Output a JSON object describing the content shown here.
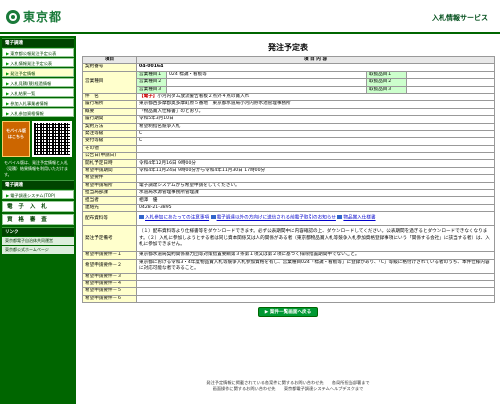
{
  "header": {
    "logo_text": "東京都",
    "service_title": "入札情報サービス"
  },
  "sidebar": {
    "section1": "電子調達",
    "items1": [
      "東京都公報発注予定公表",
      "入札情報発注予定公表",
      "発注予定情報",
      "入札見積(競)経過情報",
      "入札結果一覧",
      "参加入札事業者情報",
      "入札参加資格情報"
    ],
    "mobile_label": "モバイル版",
    "mobile_sub": "はこちら",
    "note": "モバイル版は、発注予定情報と入札（見積）結果情報を利用いただけます。",
    "section2": "電子調達",
    "items2": [
      "電子調達システム(TOP)"
    ],
    "big1": "電 子 入 札",
    "big2": "資 格 審 査",
    "section3": "リンク",
    "links": [
      "東京都電子自治体共同運営",
      "東京都公式ホームページ"
    ]
  },
  "main": {
    "page_title": "発注予定表",
    "col_item": "項目",
    "col_content": "項 目 内 容",
    "contract_no_label": "契約番号",
    "contract_no": "04-00164",
    "biz1_label": "営業種目",
    "biz1_sub1": "営業種目１",
    "biz1_val1": "024 標識・看板等",
    "biz1_sub2": "営業種目２",
    "biz1_sub3": "営業種目３",
    "biz1_r1": "取扱品目１",
    "biz1_r2": "取扱品目２",
    "biz1_r3": "取扱品目３",
    "name_label": "件　名",
    "name_tag": "【電子】",
    "name_val": "小河内ダム放流警告看板２点外４点の賞入れ",
    "place_label": "履行場所",
    "place_val": "東京都西多摩郡奥多摩町原５番地　東京都水道局小河内貯水池管理事務所",
    "summary_label": "概要",
    "summary_val": "「物品賞入仕様書」のとおり。",
    "period_label": "履行期間",
    "period_val": "令和5年3月10日",
    "method_label": "契約方法",
    "method_val": "希望制指名競争入札",
    "grade_label": "発注等級",
    "grade_val": "C",
    "acc_label": "受付等級",
    "acc_val": "C",
    "other_label": "その他",
    "pub_label": "公告日(申請日)",
    "pub_val": "",
    "open_label": "開札予定日時",
    "open_val": "令和4年12月16日 9時00分",
    "apply_label": "希望申請期間",
    "apply_val": "令和4年11月24日 9時00分から令和4年11月30日 17時00分",
    "cond_label": "希望要件",
    "cond_val": "",
    "apply_method_label": "希望申請場所",
    "apply_method_val": "電子調達システムから希望申請をしてください。",
    "dept_label": "担当局部課",
    "dept_val": "水道局水源管理事務所管理課",
    "person_label": "担当者",
    "person_val": "相澤　優",
    "tel_label": "連絡先",
    "tel_val": "0428-21-3895",
    "docs_label": "配布資料等",
    "doc1": "入札参加にあたっての注意事項",
    "doc2": "電子調達以外の方向けに送信される前電子取引のお知らせ",
    "doc3": "物品賞入仕様書",
    "caution_label": "発注予定備考",
    "caution_val": "（１）配布資料等より仕様書等をダウンロードできます。必ず公表期間中に内容確認の上、ダウンロードしてください。公表期間を過ぎるとダウンロードできなくなります。（２）入札に参加しようとする者は同じ資本関係又は人的関係がある者（東京都物品賞入札等競争入札参加資格登録事項にいう「関係する会社」に該当する者）は、入札に参加できません。",
    "req1_label": "希望申請要件－１",
    "req1_val": "東京都水道局契約関係暴力団等対策措置要綱第３条第１項又は第２項に基づく排除措置期間中でないこと。",
    "req2_label": "希望申請要件－２",
    "req2_val": "東京都における令和3・4年度物品賞入札等競争入札参加資格を有し、営業種目024「標識・看板等」に登録があり、「C」等級に格付けされている者のうち、本件仕様内容に対応可能な者であること。",
    "req3_label": "希望申請要件－３",
    "req4_label": "希望申請要件－４",
    "req5_label": "希望申請要件－５",
    "req6_label": "希望申請要件－６",
    "back_button": "案件一覧画面へ戻る"
  },
  "footer": {
    "line1": "発注予定情報に掲載されている各案件に関するお問い合わせ先　　各局所担当部署まで",
    "line2": "画面操作に関するお問い合わせ先　　東京都電子調達システムヘルプデスクまで"
  },
  "colors": {
    "brand": "#006600",
    "label_bg": "#ffffcc",
    "sub_bg": "#ccffcc"
  }
}
